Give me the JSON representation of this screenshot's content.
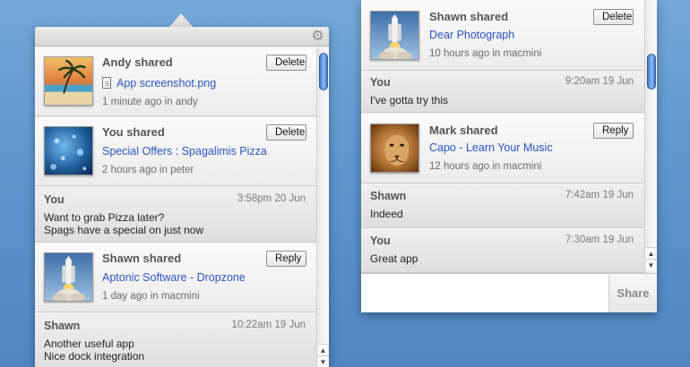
{
  "left_panel": {
    "items": [
      {
        "type": "share",
        "title": "Andy shared",
        "link": "App screenshot.png",
        "meta": "1 minute ago in andy",
        "action": "Delete",
        "thumb": "beach-photo"
      },
      {
        "type": "share",
        "title": "You shared",
        "link": "Special Offers : Spagalimis Pizza",
        "meta": "2 hours ago in peter",
        "action": "Delete",
        "thumb": "water-drops-photo"
      },
      {
        "type": "message",
        "sender": "You",
        "time": "3:58pm 20 Jun",
        "lines": [
          "Want to grab Pizza later?",
          "Spags have a special on just now"
        ]
      },
      {
        "type": "share",
        "title": "Shawn shared",
        "link": "Aptonic Software - Dropzone",
        "meta": "1 day ago in macmini",
        "action": "Reply",
        "thumb": "shuttle-launch-photo"
      },
      {
        "type": "message",
        "sender": "Shawn",
        "time": "10:22am 19 Jun",
        "lines": [
          "Another useful app",
          "Nice dock integration"
        ]
      }
    ]
  },
  "right_panel": {
    "items": [
      {
        "type": "share",
        "title": "Shawn shared",
        "link": "Dear Photograph",
        "meta": "10 hours ago in macmini",
        "action": "Delete",
        "thumb": "shuttle-launch-photo"
      },
      {
        "type": "message",
        "sender": "You",
        "time": "9:20am 19 Jun",
        "lines": [
          "I've gotta try this"
        ]
      },
      {
        "type": "share",
        "title": "Mark shared",
        "link": "Capo - Learn Your Music",
        "meta": "12 hours ago in macmini",
        "action": "Reply",
        "thumb": "lion-photo"
      },
      {
        "type": "message",
        "sender": "Shawn",
        "time": "7:42am 19 Jun",
        "lines": [
          "Indeed"
        ]
      },
      {
        "type": "message",
        "sender": "You",
        "time": "7:30am 19 Jun",
        "lines": [
          "Great app"
        ]
      }
    ],
    "compose": {
      "value": "",
      "share_label": "Share"
    }
  },
  "colors": {
    "link": "#2a57c4",
    "desktop": "#5f97cf",
    "scroll_thumb": "#5a93dc"
  }
}
